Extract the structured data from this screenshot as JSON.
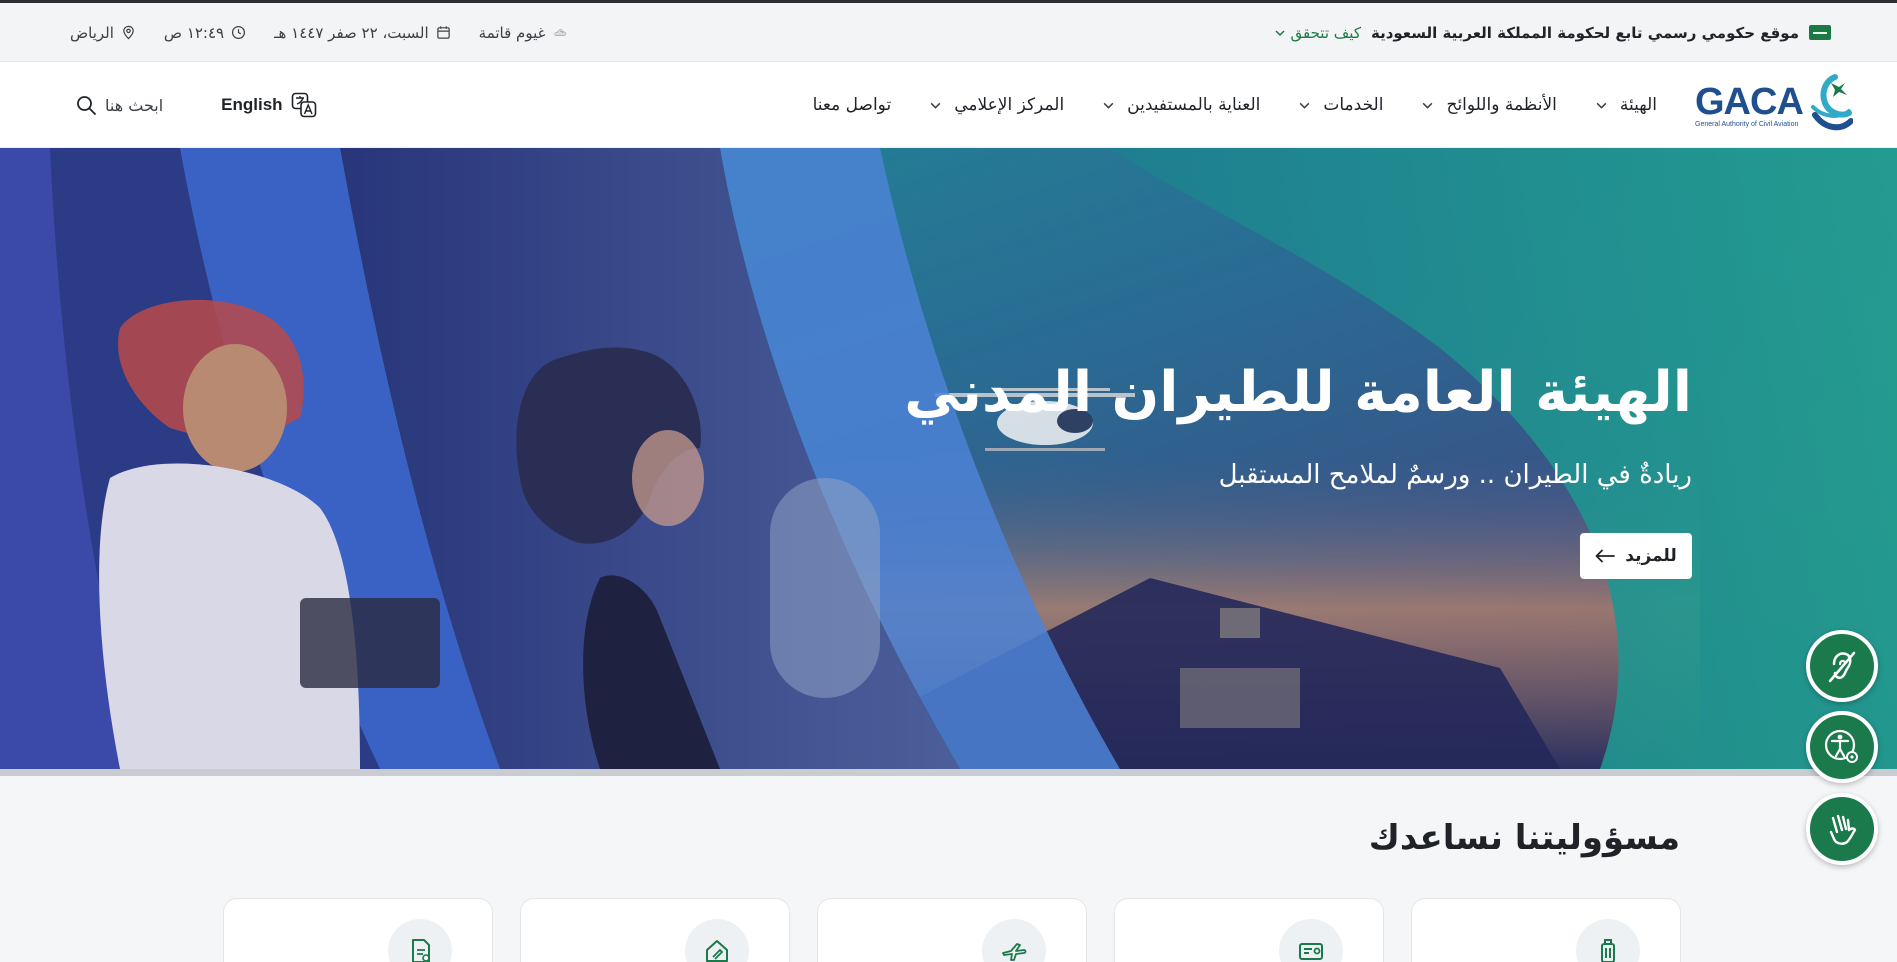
{
  "topbar": {
    "official_text": "موقع حكومي رسمي تابع لحكومة المملكة العربية السعودية",
    "verify_label": "كيف تتحقق",
    "weather": "غيوم قاتمة",
    "date": "السبت، ٢٢ صفر ١٤٤٧ هـ",
    "time": "١٢:٤٩ ص",
    "city": "الرياض"
  },
  "header": {
    "logo_text": "GACA",
    "logo_subtitle": "General Authority of Civil Aviation",
    "nav": [
      {
        "label": "الهيئة"
      },
      {
        "label": "الأنظمة واللوائح"
      },
      {
        "label": "الخدمات"
      },
      {
        "label": "العناية بالمستفيدين"
      },
      {
        "label": "المركز الإعلامي"
      },
      {
        "label": "تواصل معنا"
      }
    ],
    "lang_label": "English",
    "search_label": "ابحث هنا"
  },
  "hero": {
    "title": "الهيئة العامة للطيران المدني",
    "subtitle": "ريادةٌ في الطيران .. ورسمٌ لملامح المستقبل",
    "button_label": "للمزيد"
  },
  "section": {
    "title": "مسؤوليتنا نساعدك"
  },
  "colors": {
    "brand_green": "#1b7a4b",
    "hero_blue": "#2c3f8a",
    "hero_teal": "#1e9a94"
  },
  "icons": {
    "floating": [
      "hearing-icon",
      "accessibility-settings-icon",
      "sign-language-icon"
    ],
    "cards": [
      "luggage-icon",
      "id-card-icon",
      "plane-icon",
      "home-icon",
      "document-icon"
    ]
  }
}
